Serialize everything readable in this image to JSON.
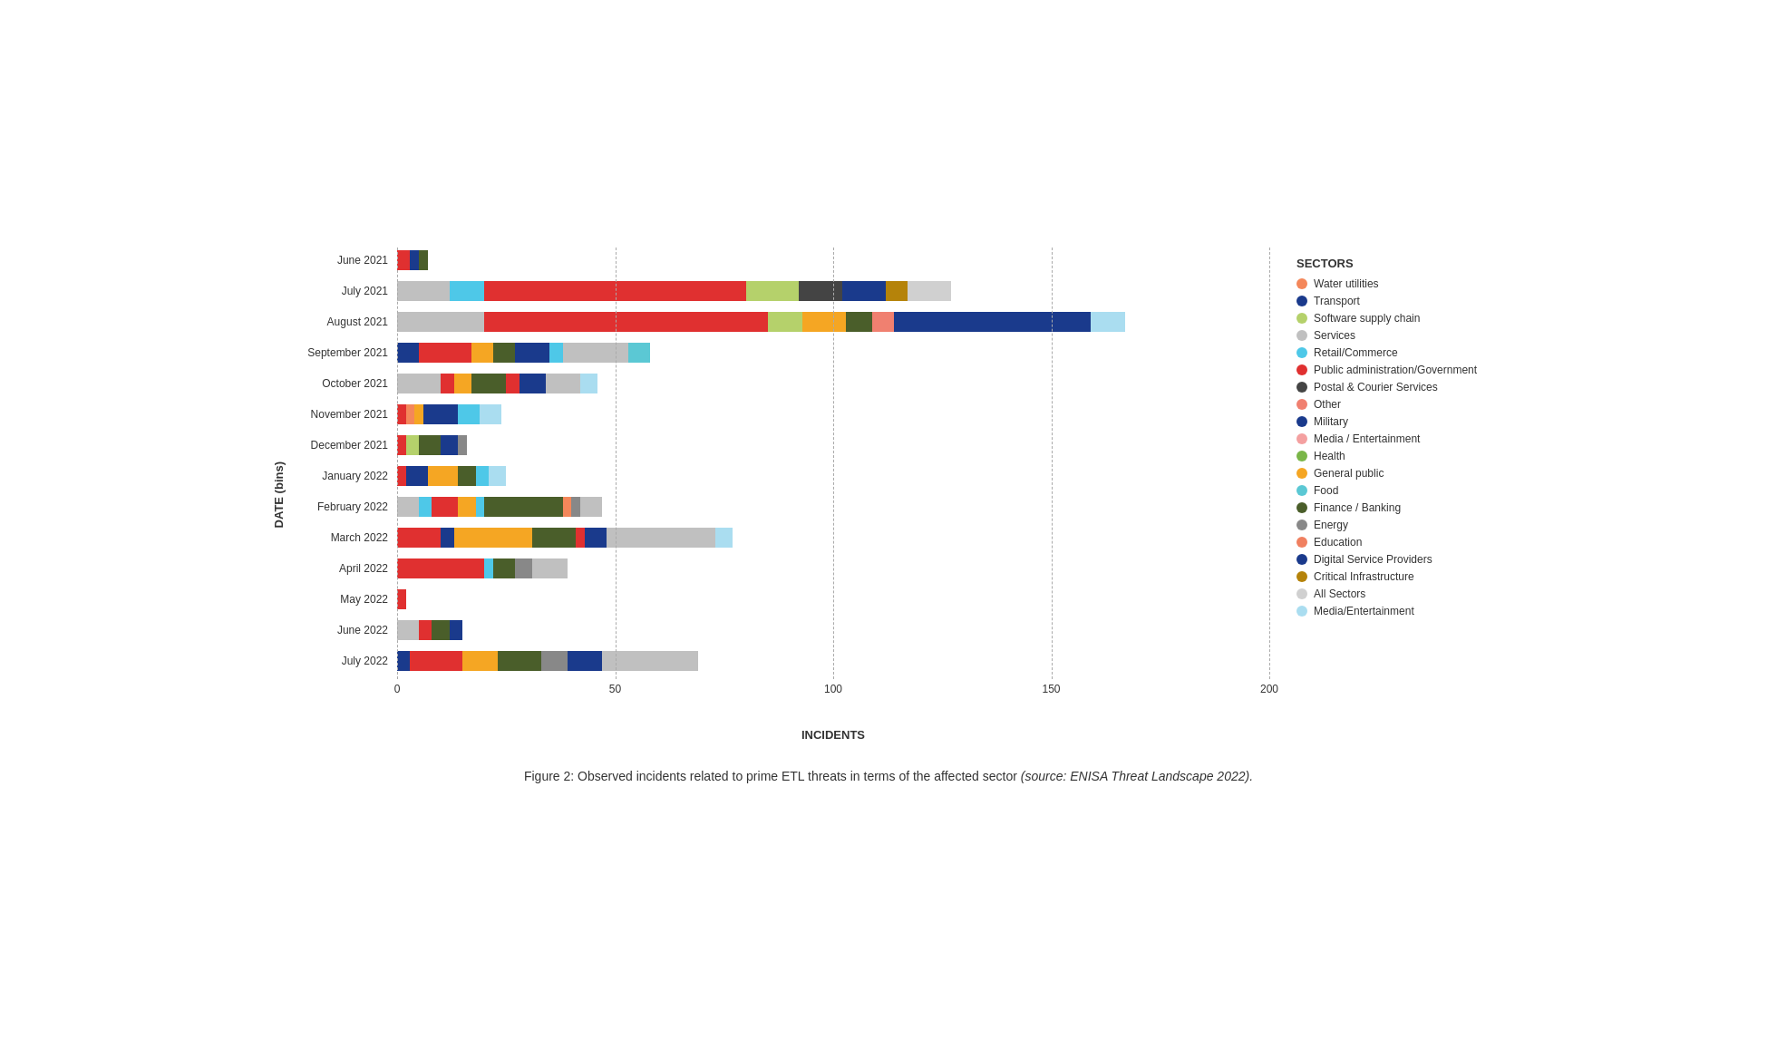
{
  "chart": {
    "title": "Figure 2: Observed incidents related to prime ETL threats in terms of the affected sector",
    "title_source": "(source: ENISA Threat Landscape 2022).",
    "y_axis_label": "DATE (bins)",
    "x_axis_label": "INCIDENTS",
    "x_ticks": [
      0,
      50,
      100,
      150,
      200
    ],
    "max_value": 200,
    "legend_title": "SECTORS",
    "legend_items": [
      {
        "label": "Water utilities",
        "color": "#f4875a"
      },
      {
        "label": "Transport",
        "color": "#1a3a8c"
      },
      {
        "label": "Software supply chain",
        "color": "#b5d16b"
      },
      {
        "label": "Services",
        "color": "#c0c0c0"
      },
      {
        "label": "Retail/Commerce",
        "color": "#4ec8e8"
      },
      {
        "label": "Public administration/Government",
        "color": "#e03030"
      },
      {
        "label": "Postal & Courier Services",
        "color": "#444444"
      },
      {
        "label": "Other",
        "color": "#f08070"
      },
      {
        "label": "Military",
        "color": "#1a3a8c"
      },
      {
        "label": "Media / Entertainment",
        "color": "#f4a0a0"
      },
      {
        "label": "Health",
        "color": "#7ab648"
      },
      {
        "label": "General public",
        "color": "#f5a623"
      },
      {
        "label": "Food",
        "color": "#5bc8d4"
      },
      {
        "label": "Finance / Banking",
        "color": "#4a5e2a"
      },
      {
        "label": "Energy",
        "color": "#888888"
      },
      {
        "label": "Education",
        "color": "#f08060"
      },
      {
        "label": "Digital Service Providers",
        "color": "#1a3a8c"
      },
      {
        "label": "Critical Infrastructure",
        "color": "#b5830a"
      },
      {
        "label": "All Sectors",
        "color": "#d0d0d0"
      },
      {
        "label": "Media/Entertainment",
        "color": "#aaddf0"
      }
    ],
    "rows": [
      {
        "label": "June 2021",
        "segments": [
          {
            "color": "#e03030",
            "value": 3
          },
          {
            "color": "#1a3a8c",
            "value": 2
          },
          {
            "color": "#4a5e2a",
            "value": 2
          }
        ]
      },
      {
        "label": "July 2021",
        "segments": [
          {
            "color": "#c0c0c0",
            "value": 12
          },
          {
            "color": "#4ec8e8",
            "value": 8
          },
          {
            "color": "#e03030",
            "value": 60
          },
          {
            "color": "#b5d16b",
            "value": 12
          },
          {
            "color": "#444444",
            "value": 10
          },
          {
            "color": "#1a3a8c",
            "value": 10
          },
          {
            "color": "#b5830a",
            "value": 5
          },
          {
            "color": "#d0d0d0",
            "value": 10
          }
        ]
      },
      {
        "label": "August 2021",
        "segments": [
          {
            "color": "#c0c0c0",
            "value": 20
          },
          {
            "color": "#e03030",
            "value": 65
          },
          {
            "color": "#b5d16b",
            "value": 8
          },
          {
            "color": "#f5a623",
            "value": 10
          },
          {
            "color": "#4a5e2a",
            "value": 6
          },
          {
            "color": "#f08070",
            "value": 5
          },
          {
            "color": "#1a3a8c",
            "value": 45
          },
          {
            "color": "#aaddf0",
            "value": 8
          }
        ]
      },
      {
        "label": "September 2021",
        "segments": [
          {
            "color": "#1a3a8c",
            "value": 5
          },
          {
            "color": "#e03030",
            "value": 12
          },
          {
            "color": "#f5a623",
            "value": 5
          },
          {
            "color": "#4a5e2a",
            "value": 5
          },
          {
            "color": "#1a3a8c",
            "value": 8
          },
          {
            "color": "#4ec8e8",
            "value": 3
          },
          {
            "color": "#c0c0c0",
            "value": 15
          },
          {
            "color": "#5bc8d4",
            "value": 5
          }
        ]
      },
      {
        "label": "October 2021",
        "segments": [
          {
            "color": "#c0c0c0",
            "value": 10
          },
          {
            "color": "#e03030",
            "value": 3
          },
          {
            "color": "#f5a623",
            "value": 4
          },
          {
            "color": "#4a5e2a",
            "value": 8
          },
          {
            "color": "#e03030",
            "value": 3
          },
          {
            "color": "#1a3a8c",
            "value": 6
          },
          {
            "color": "#c0c0c0",
            "value": 8
          },
          {
            "color": "#aaddf0",
            "value": 4
          }
        ]
      },
      {
        "label": "November 2021",
        "segments": [
          {
            "color": "#e03030",
            "value": 2
          },
          {
            "color": "#f4875a",
            "value": 2
          },
          {
            "color": "#f5a623",
            "value": 2
          },
          {
            "color": "#1a3a8c",
            "value": 8
          },
          {
            "color": "#4ec8e8",
            "value": 5
          },
          {
            "color": "#aaddf0",
            "value": 5
          }
        ]
      },
      {
        "label": "December 2021",
        "segments": [
          {
            "color": "#e03030",
            "value": 2
          },
          {
            "color": "#b5d16b",
            "value": 3
          },
          {
            "color": "#4a5e2a",
            "value": 5
          },
          {
            "color": "#1a3a8c",
            "value": 4
          },
          {
            "color": "#888888",
            "value": 2
          }
        ]
      },
      {
        "label": "January 2022",
        "segments": [
          {
            "color": "#e03030",
            "value": 2
          },
          {
            "color": "#1a3a8c",
            "value": 5
          },
          {
            "color": "#f5a623",
            "value": 7
          },
          {
            "color": "#4a5e2a",
            "value": 4
          },
          {
            "color": "#4ec8e8",
            "value": 3
          },
          {
            "color": "#aaddf0",
            "value": 4
          }
        ]
      },
      {
        "label": "February 2022",
        "segments": [
          {
            "color": "#c0c0c0",
            "value": 5
          },
          {
            "color": "#4ec8e8",
            "value": 3
          },
          {
            "color": "#e03030",
            "value": 6
          },
          {
            "color": "#f5a623",
            "value": 4
          },
          {
            "color": "#4ec8e8",
            "value": 2
          },
          {
            "color": "#4a5e2a",
            "value": 18
          },
          {
            "color": "#f4875a",
            "value": 2
          },
          {
            "color": "#888888",
            "value": 2
          },
          {
            "color": "#c0c0c0",
            "value": 5
          }
        ]
      },
      {
        "label": "March 2022",
        "segments": [
          {
            "color": "#e03030",
            "value": 10
          },
          {
            "color": "#1a3a8c",
            "value": 3
          },
          {
            "color": "#f5a623",
            "value": 18
          },
          {
            "color": "#4a5e2a",
            "value": 10
          },
          {
            "color": "#e03030",
            "value": 2
          },
          {
            "color": "#1a3a8c",
            "value": 5
          },
          {
            "color": "#c0c0c0",
            "value": 25
          },
          {
            "color": "#aaddf0",
            "value": 4
          }
        ]
      },
      {
        "label": "April 2022",
        "segments": [
          {
            "color": "#e03030",
            "value": 20
          },
          {
            "color": "#4ec8e8",
            "value": 2
          },
          {
            "color": "#4a5e2a",
            "value": 5
          },
          {
            "color": "#888888",
            "value": 4
          },
          {
            "color": "#c0c0c0",
            "value": 8
          }
        ]
      },
      {
        "label": "May 2022",
        "segments": [
          {
            "color": "#e03030",
            "value": 2
          }
        ]
      },
      {
        "label": "June 2022",
        "segments": [
          {
            "color": "#c0c0c0",
            "value": 5
          },
          {
            "color": "#e03030",
            "value": 3
          },
          {
            "color": "#4a5e2a",
            "value": 4
          },
          {
            "color": "#1a3a8c",
            "value": 3
          }
        ]
      },
      {
        "label": "July 2022",
        "segments": [
          {
            "color": "#1a3a8c",
            "value": 3
          },
          {
            "color": "#e03030",
            "value": 12
          },
          {
            "color": "#f5a623",
            "value": 8
          },
          {
            "color": "#4a5e2a",
            "value": 10
          },
          {
            "color": "#888888",
            "value": 6
          },
          {
            "color": "#1a3a8c",
            "value": 8
          },
          {
            "color": "#c0c0c0",
            "value": 22
          }
        ]
      }
    ]
  }
}
